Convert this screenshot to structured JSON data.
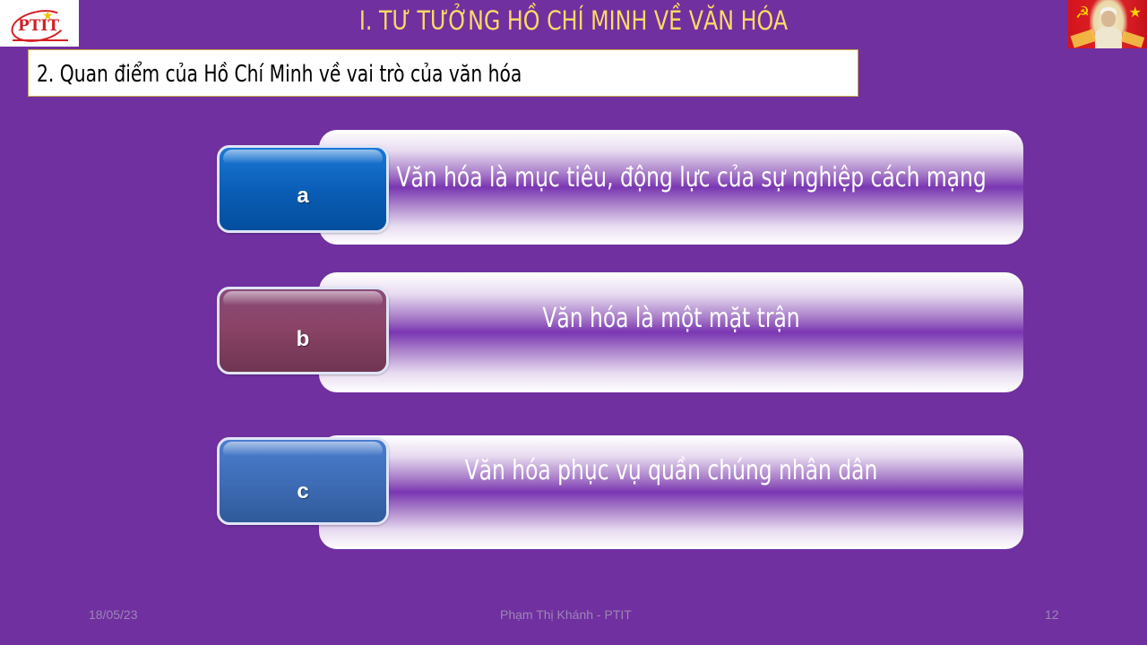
{
  "header": {
    "title": "I. TƯ TƯỞNG HỒ CHÍ MINH VỀ VĂN HÓA",
    "logo_left": "PTIT",
    "logo_left_icon": "ptit-logo",
    "logo_right_icon": "ho-chi-minh-portrait-flag"
  },
  "subtitle": "2. Quan điểm của Hồ Chí Minh về vai trò của văn hóa",
  "items": [
    {
      "letter": "a",
      "text": "Văn hóa là mục tiêu, động lực của sự nghiệp cách mạng",
      "color": "#0a5cb4"
    },
    {
      "letter": "b",
      "text": "Văn hóa là một mặt trận",
      "color": "#8b4466"
    },
    {
      "letter": "c",
      "text": "Văn hóa phục vụ quần chúng nhân dân",
      "color": "#3d6bb4"
    }
  ],
  "footer": {
    "date": "18/05/23",
    "author": "Phạm Thị Khánh - PTIT",
    "page": "12"
  },
  "colors": {
    "background": "#7030a0",
    "title": "#ffd966"
  }
}
